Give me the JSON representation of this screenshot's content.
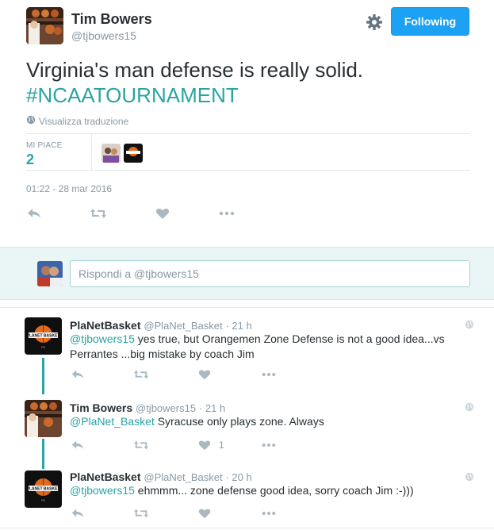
{
  "header": {
    "name": "Tim Bowers",
    "handle": "@tjbowers15",
    "follow_label": "Following"
  },
  "tweet": {
    "text": "Virginia's man defense is really solid.",
    "hashtag": "#NCAATOURNAMENT",
    "translate_label": "Visualizza traduzione",
    "likes_label": "MI PIACE",
    "likes_count": "2",
    "timestamp": "01:22 - 28 mar 2016"
  },
  "reply_box": {
    "placeholder": "Rispondi a @tjbowers15"
  },
  "replies": [
    {
      "name": "PlaNetBasket",
      "handle": "@PlaNet_Basket",
      "time": "· 21 h",
      "mention": "@tjbowers15",
      "text_line1": " yes true, but Orangemen Zone Defense is not a good idea...vs",
      "text_line2": "Perrantes ...big mistake by coach Jim"
    },
    {
      "name": "Tim Bowers",
      "handle": "@tjbowers15",
      "time": "· 21 h",
      "mention": "@PlaNet_Basket",
      "text_line1": " Syracuse only plays zone. Always",
      "like_count": "1"
    },
    {
      "name": "PlaNetBasket",
      "handle": "@PlaNet_Basket",
      "time": "· 20 h",
      "mention": "@tjbowers15",
      "text_line1": " ehmmm... zone defense good idea, sorry coach Jim :-)))"
    }
  ],
  "colors": {
    "accent": "#2aa3a5",
    "follow_button": "#1da1f2",
    "muted": "#8899a6",
    "reply_band": "#eaf6f6"
  },
  "icons": [
    "settings-gear-icon",
    "globe-icon",
    "reply-icon",
    "retweet-icon",
    "heart-icon",
    "more-icon"
  ]
}
